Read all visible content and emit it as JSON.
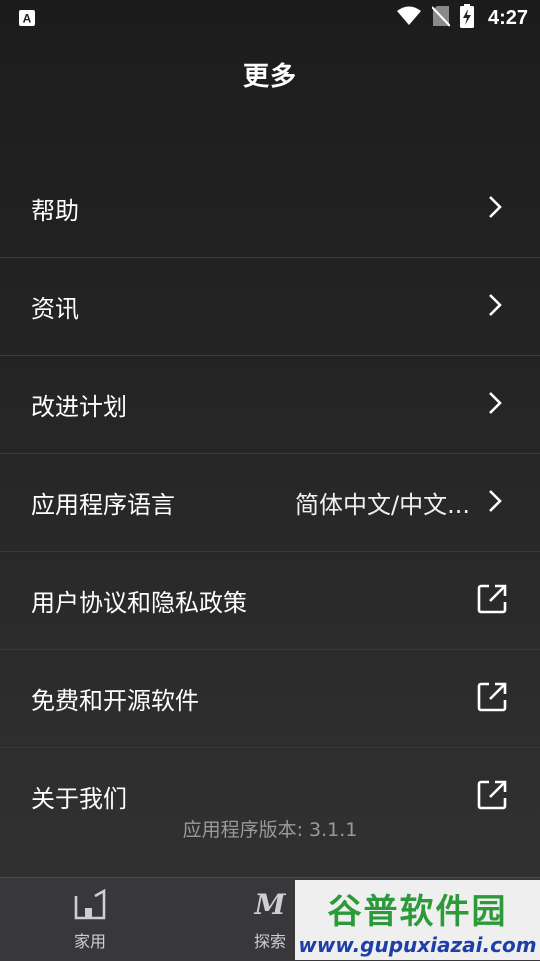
{
  "status_bar": {
    "time": "4:27",
    "icons": [
      "app-notification-icon",
      "wifi-icon",
      "no-sim-icon",
      "battery-charging-icon"
    ]
  },
  "header": {
    "title": "更多"
  },
  "menu": {
    "items": [
      {
        "label": "帮助",
        "type": "chevron"
      },
      {
        "label": "资讯",
        "type": "chevron"
      },
      {
        "label": "改进计划",
        "type": "chevron"
      },
      {
        "label": "应用程序语言",
        "value": "简体中文/中文...",
        "type": "chevron"
      },
      {
        "label": "用户协议和隐私政策",
        "type": "external"
      },
      {
        "label": "免费和开源软件",
        "type": "external"
      },
      {
        "label": "关于我们",
        "type": "external"
      }
    ],
    "version": "应用程序版本: 3.1.1"
  },
  "bottom_nav": {
    "items": [
      {
        "label": "家用",
        "icon": "home-icon"
      },
      {
        "label": "探索",
        "icon": "explore-icon"
      }
    ]
  },
  "watermark": {
    "main": "谷普软件园",
    "sub": "www.gupuxiazai.com"
  }
}
